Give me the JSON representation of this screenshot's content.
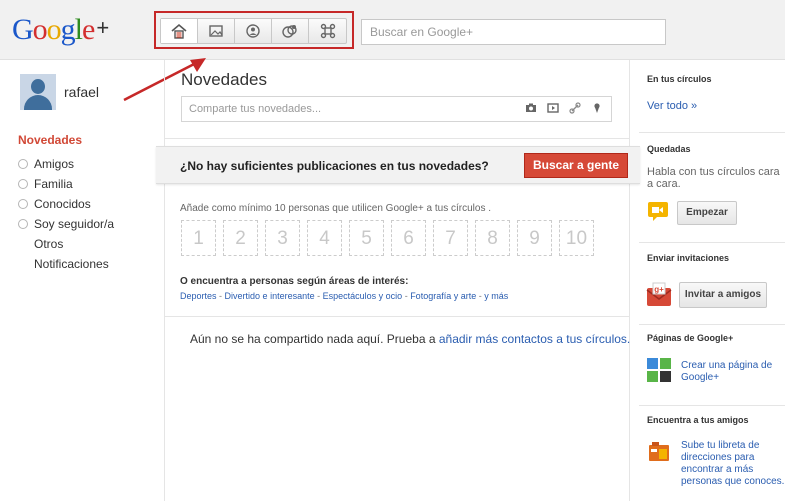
{
  "header": {
    "logo": {
      "google": [
        "G",
        "o",
        "o",
        "g",
        "l",
        "e"
      ],
      "plus": "+"
    },
    "nav_icons": [
      "home-icon",
      "photos-icon",
      "profile-icon",
      "circles-icon",
      "games-icon"
    ],
    "search_placeholder": "Buscar en Google+"
  },
  "profile": {
    "name": "rafael"
  },
  "left_nav": {
    "title": "Novedades",
    "circles": [
      "Amigos",
      "Familia",
      "Conocidos",
      "Soy seguidor/a"
    ],
    "others": [
      "Otros",
      "Notificaciones"
    ]
  },
  "stream": {
    "title": "Novedades",
    "share_placeholder": "Comparte tus novedades...",
    "share_icons": [
      "camera-icon",
      "video-icon",
      "link-icon",
      "location-icon"
    ],
    "banner": {
      "text": "¿No hay suficientes publicaciones en tus novedades?",
      "button": "Buscar a gente"
    },
    "hint": "Añade como mínimo 10 personas que utilicen Google+ a tus círculos .",
    "numbers": [
      "1",
      "2",
      "3",
      "4",
      "5",
      "6",
      "7",
      "8",
      "9",
      "10"
    ],
    "interest_title": "O encuentra a personas según áreas de interés:",
    "interests": [
      "Deportes",
      "Divertido e interesante",
      "Espectáculos y ocio",
      "Fotografía y arte",
      "y más"
    ],
    "empty_text": "Aún no se ha compartido nada aquí. Prueba a ",
    "empty_link": "añadir más contactos a tus círculos."
  },
  "right": {
    "circles": {
      "title": "En tus círculos",
      "link": "Ver todo »"
    },
    "hangouts": {
      "title": "Quedadas",
      "text": "Habla con tus círculos cara a cara.",
      "button": "Empezar"
    },
    "invite": {
      "title": "Enviar invitaciones",
      "button": "Invitar a amigos"
    },
    "pages": {
      "title": "Páginas de Google+",
      "link": "Crear una página de Google+"
    },
    "friends": {
      "title": "Encuentra a tus amigos",
      "link": "Sube tu libreta de direcciones para encontrar a más personas que conoces."
    }
  },
  "colors": {
    "accent_red": "#d64937",
    "link_blue": "#2a5db0",
    "highlight_red": "#c62828"
  }
}
